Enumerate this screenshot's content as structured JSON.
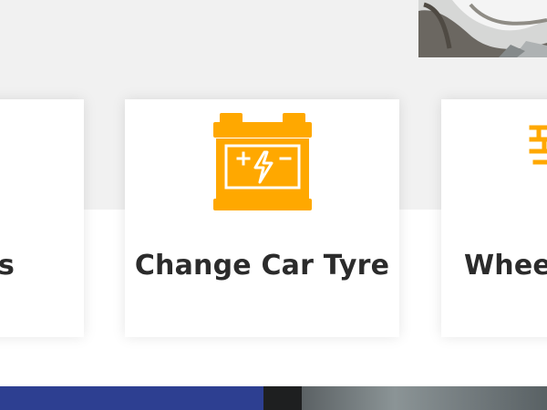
{
  "theme": {
    "accent": "#ffa800",
    "card_text": "#2b2b2b",
    "band_background": "#f1f1f1",
    "footer_blue": "#2d3f91"
  },
  "services": {
    "cards": [
      {
        "title": "s",
        "icon": "none"
      },
      {
        "title": "Change Car Tyre",
        "icon": "battery-icon"
      },
      {
        "title": "Wheel",
        "icon": "wheel-alignment-icon"
      }
    ]
  },
  "media": {
    "hero_photo": "car-service-photo",
    "footer_photo": "workshop-photo"
  }
}
